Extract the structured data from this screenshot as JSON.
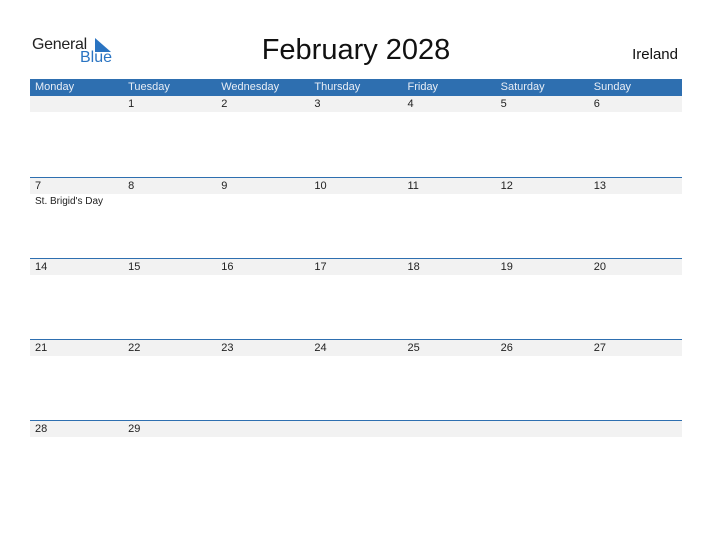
{
  "logo": {
    "general": "General",
    "blue": "Blue"
  },
  "title": "February 2028",
  "country": "Ireland",
  "weekdays": [
    "Monday",
    "Tuesday",
    "Wednesday",
    "Thursday",
    "Friday",
    "Saturday",
    "Sunday"
  ],
  "weeks": [
    {
      "days": [
        "",
        "1",
        "2",
        "3",
        "4",
        "5",
        "6"
      ],
      "events": [
        "",
        "",
        "",
        "",
        "",
        "",
        ""
      ]
    },
    {
      "days": [
        "7",
        "8",
        "9",
        "10",
        "11",
        "12",
        "13"
      ],
      "events": [
        "St. Brigid's Day",
        "",
        "",
        "",
        "",
        "",
        ""
      ]
    },
    {
      "days": [
        "14",
        "15",
        "16",
        "17",
        "18",
        "19",
        "20"
      ],
      "events": [
        "",
        "",
        "",
        "",
        "",
        "",
        ""
      ]
    },
    {
      "days": [
        "21",
        "22",
        "23",
        "24",
        "25",
        "26",
        "27"
      ],
      "events": [
        "",
        "",
        "",
        "",
        "",
        "",
        ""
      ]
    },
    {
      "days": [
        "28",
        "29",
        "",
        "",
        "",
        "",
        ""
      ],
      "events": [
        "",
        "",
        "",
        "",
        "",
        "",
        ""
      ]
    }
  ],
  "colors": {
    "accent": "#2e6fb0",
    "logo_blue": "#2a74c2",
    "date_strip": "#f2f2f2"
  }
}
